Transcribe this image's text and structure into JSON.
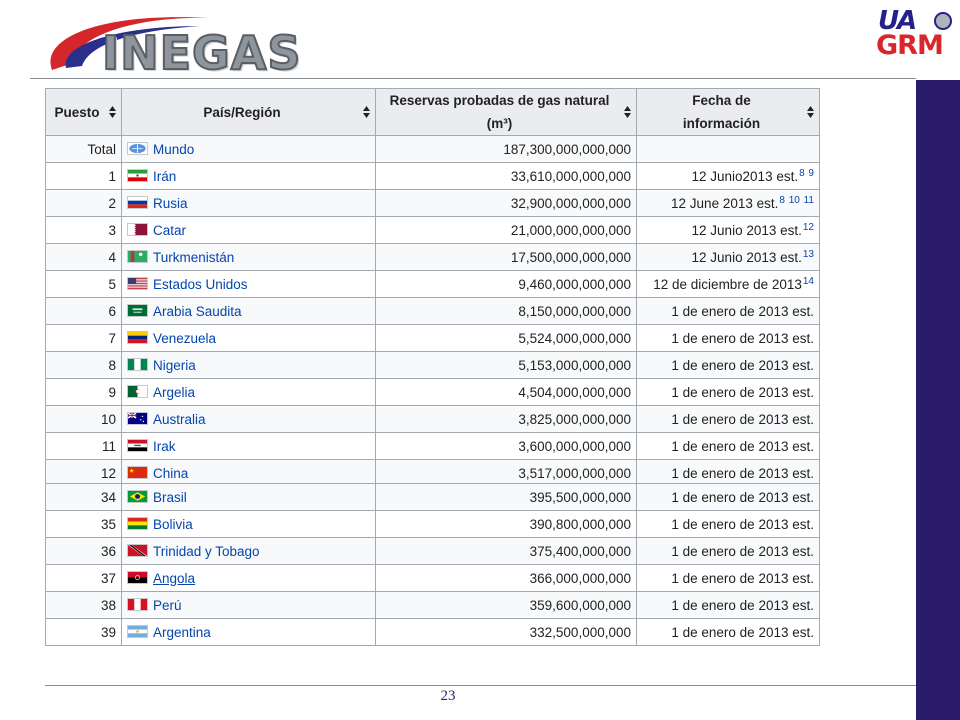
{
  "page_number": "23",
  "logos": {
    "inegas": "INEGAS",
    "uagrm_top": "UA",
    "uagrm_bottom": "GRM"
  },
  "colors": {
    "sidebar": "#2b1b6b",
    "link": "#0645ad",
    "header_bg": "#eaecf0",
    "border": "#a2a9b1"
  },
  "table": {
    "headers": {
      "rank": "Puesto",
      "country": "País/Región",
      "reserves_line1": "Reservas probadas de gas natural",
      "reserves_line2": "(m³)",
      "date_line1": "Fecha de",
      "date_line2": "información"
    },
    "rows_top": [
      {
        "rank": "Total",
        "flag": "world",
        "country": "Mundo",
        "reserves": "187,300,000,000,000",
        "date": "",
        "refs": ""
      },
      {
        "rank": "1",
        "flag": "iran",
        "country": "Irán",
        "reserves": "33,610,000,000,000",
        "date": "12 Junio2013 est.",
        "refs": "8 9"
      },
      {
        "rank": "2",
        "flag": "russia",
        "country": "Rusia",
        "reserves": "32,900,000,000,000",
        "date": "12 June 2013 est.",
        "refs": "8 10 11"
      },
      {
        "rank": "3",
        "flag": "qatar",
        "country": "Catar",
        "reserves": "21,000,000,000,000",
        "date": "12 Junio 2013 est.",
        "refs": "12"
      },
      {
        "rank": "4",
        "flag": "turkmenistan",
        "country": "Turkmenistán",
        "reserves": "17,500,000,000,000",
        "date": "12 Junio 2013 est.",
        "refs": "13"
      },
      {
        "rank": "5",
        "flag": "usa",
        "country": "Estados Unidos",
        "reserves": "9,460,000,000,000",
        "date": "12 de diciembre de 2013",
        "refs": "14"
      },
      {
        "rank": "6",
        "flag": "saudi",
        "country": "Arabia Saudita",
        "reserves": "8,150,000,000,000",
        "date": "1 de enero de 2013 est.",
        "refs": ""
      },
      {
        "rank": "7",
        "flag": "venezuela",
        "country": "Venezuela",
        "reserves": "5,524,000,000,000",
        "date": "1 de enero de 2013 est.",
        "refs": ""
      },
      {
        "rank": "8",
        "flag": "nigeria",
        "country": "Nigeria",
        "reserves": "5,153,000,000,000",
        "date": "1 de enero de 2013 est.",
        "refs": ""
      },
      {
        "rank": "9",
        "flag": "algeria",
        "country": "Argelia",
        "reserves": "4,504,000,000,000",
        "date": "1 de enero de 2013 est.",
        "refs": ""
      },
      {
        "rank": "10",
        "flag": "australia",
        "country": "Australia",
        "reserves": "3,825,000,000,000",
        "date": "1 de enero de 2013 est.",
        "refs": ""
      },
      {
        "rank": "11",
        "flag": "iraq",
        "country": "Irak",
        "reserves": "3,600,000,000,000",
        "date": "1 de enero de 2013 est.",
        "refs": ""
      },
      {
        "rank": "12",
        "flag": "china",
        "country": "China",
        "reserves": "3,517,000,000,000",
        "date": "1 de enero de 2013 est.",
        "refs": ""
      }
    ],
    "rows_bottom": [
      {
        "rank": "34",
        "flag": "brazil",
        "country": "Brasil",
        "reserves": "395,500,000,000",
        "date": "1 de enero de 2013 est.",
        "refs": ""
      },
      {
        "rank": "35",
        "flag": "bolivia",
        "country": "Bolivia",
        "reserves": "390,800,000,000",
        "date": "1 de enero de 2013 est.",
        "refs": ""
      },
      {
        "rank": "36",
        "flag": "trinidad",
        "country": "Trinidad y Tobago",
        "reserves": "375,400,000,000",
        "date": "1 de enero de 2013 est.",
        "refs": ""
      },
      {
        "rank": "37",
        "flag": "angola",
        "country": "Angola",
        "reserves": "366,000,000,000",
        "date": "1 de enero de 2013 est.",
        "refs": "",
        "visited": true
      },
      {
        "rank": "38",
        "flag": "peru",
        "country": "Perú",
        "reserves": "359,600,000,000",
        "date": "1 de enero de 2013 est.",
        "refs": ""
      },
      {
        "rank": "39",
        "flag": "argentina",
        "country": "Argentina",
        "reserves": "332,500,000,000",
        "date": "1 de enero de 2013 est.",
        "refs": ""
      }
    ]
  }
}
